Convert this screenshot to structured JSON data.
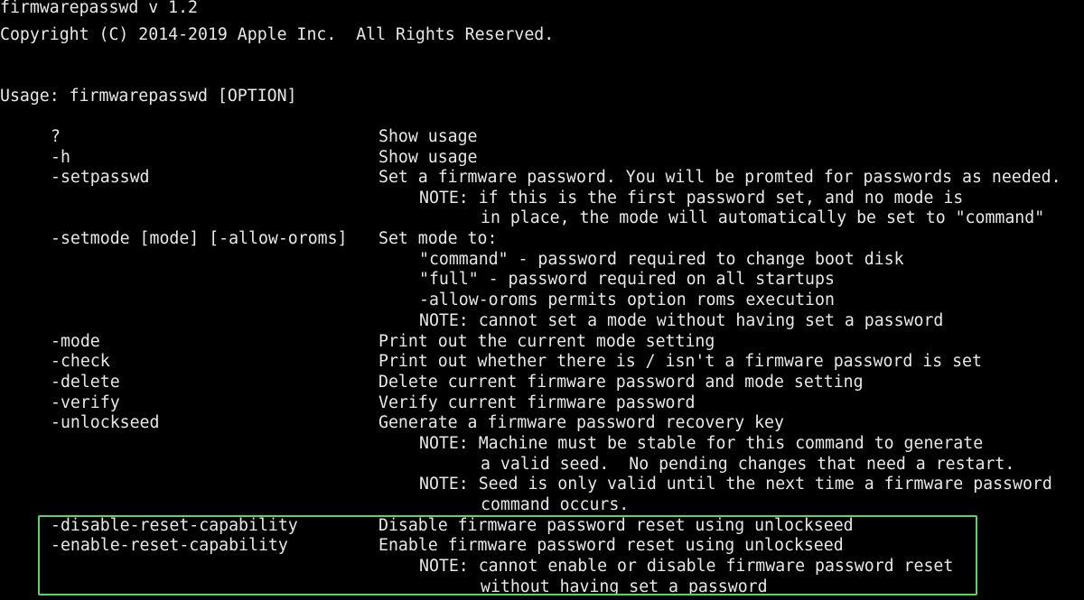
{
  "header": {
    "title": "firmwarepasswd v 1.2",
    "copyright": "Copyright (C) 2014-2019 Apple Inc.  All Rights Reserved."
  },
  "usage": "Usage: firmwarepasswd [OPTION]",
  "options": [
    {
      "flag": "?",
      "desc": "Show usage"
    },
    {
      "flag": "-h",
      "desc": "Show usage"
    },
    {
      "flag": "-setpasswd",
      "desc": "Set a firmware password. You will be promted for passwords as needed.",
      "notes": [
        "NOTE: if this is the first password set, and no mode is",
        "in place, the mode will automatically be set to \"command\""
      ]
    },
    {
      "flag": "-setmode [mode] [-allow-oroms]",
      "desc": "Set mode to:",
      "notes": [
        "\"command\" - password required to change boot disk",
        "\"full\" - password required on all startups",
        "-allow-oroms permits option roms execution",
        "NOTE: cannot set a mode without having set a password"
      ]
    },
    {
      "flag": "-mode",
      "desc": "Print out the current mode setting"
    },
    {
      "flag": "-check",
      "desc": "Print out whether there is / isn't a firmware password is set"
    },
    {
      "flag": "-delete",
      "desc": "Delete current firmware password and mode setting"
    },
    {
      "flag": "-verify",
      "desc": "Verify current firmware password"
    },
    {
      "flag": "-unlockseed",
      "desc": "Generate a firmware password recovery key",
      "notes": [
        "NOTE: Machine must be stable for this command to generate",
        "a valid seed.  No pending changes that need a restart.",
        "NOTE: Seed is only valid until the next time a firmware password",
        "command occurs."
      ]
    },
    {
      "flag": "-disable-reset-capability",
      "desc": "Disable firmware password reset using unlockseed"
    },
    {
      "flag": "-enable-reset-capability",
      "desc": "Enable firmware password reset using unlockseed",
      "notes": [
        "NOTE: cannot enable or disable firmware password reset",
        "without having set a password"
      ]
    }
  ],
  "colors": {
    "background": "#000000",
    "text": "#e8e8e8",
    "highlight_border": "#5fd35f"
  }
}
